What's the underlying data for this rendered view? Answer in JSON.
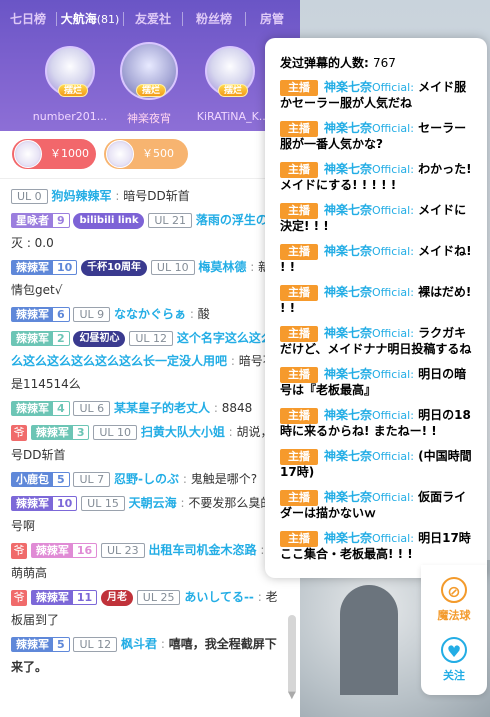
{
  "tabs": [
    {
      "label": "七日榜",
      "count": ""
    },
    {
      "label": "大航海",
      "count": "(81)"
    },
    {
      "label": "友爱社",
      "count": ""
    },
    {
      "label": "粉丝榜",
      "count": ""
    },
    {
      "label": "房管",
      "count": ""
    }
  ],
  "rank_badge": "摆烂",
  "rank_names": [
    "number201...",
    "神楽夜宵",
    "KiRATiNA_K..."
  ],
  "gifts": [
    {
      "text": "￥1000",
      "color": "#f2676b"
    },
    {
      "text": "￥500",
      "color": "#f7b470"
    }
  ],
  "chat": [
    {
      "fan": "UL 0",
      "fan_lv": "",
      "ul": "",
      "guard": "",
      "medal": "",
      "user": "狗妈辣辣军",
      "sep": ":",
      "text": "暗号DD斩首",
      "fan_color": "#ffffff",
      "plain_ul": "UL 0"
    },
    {
      "fan": "星咏者",
      "fan_lv": "9",
      "ul": "UL 21",
      "guard": "",
      "medal": "bilibili link",
      "user": "落雨の浮生の",
      "sep": "",
      "text": "幻灭 : 0.0",
      "fan_color": "#9b7ede"
    },
    {
      "fan": "辣辣军",
      "fan_lv": "10",
      "ul": "UL 10",
      "guard": "",
      "medal": "千杯10周年",
      "user": "梅莫林德",
      "sep": ":",
      "text": "新表情包get√",
      "fan_color": "#5f88d9"
    },
    {
      "fan": "辣辣军",
      "fan_lv": "6",
      "ul": "UL 9",
      "guard": "",
      "medal": "",
      "user": "ななかぐらぁ",
      "sep": ":",
      "text": "酸",
      "fan_color": "#5f88d9"
    },
    {
      "fan": "辣辣军",
      "fan_lv": "2",
      "ul": "UL 12",
      "guard": "",
      "medal": "幻昼初心",
      "user": "这个名字这么这么这么这么这么这么这么这么长一定没人用吧",
      "sep": ":",
      "text": "暗号不是114514么",
      "fan_color": "#6cc5b5"
    },
    {
      "fan": "辣辣军",
      "fan_lv": "4",
      "ul": "UL 6",
      "guard": "",
      "medal": "",
      "user": "某某皇子的老丈人",
      "sep": ":",
      "text": "8848",
      "fan_color": "#6cc5b5"
    },
    {
      "fan": "辣辣军",
      "fan_lv": "3",
      "ul": "UL 10",
      "guard": "爷",
      "medal": "",
      "user": "扫黄大队大小姐",
      "sep": ":",
      "text": "胡说，暗号DD斩首",
      "fan_color": "#6cc5b5"
    },
    {
      "fan": "小鹿包",
      "fan_lv": "5",
      "ul": "UL 7",
      "guard": "",
      "medal": "",
      "user": "忍野-しのぶ",
      "sep": ":",
      "text": "鬼触是哪个?",
      "fan_color": "#5f88d9"
    },
    {
      "fan": "辣辣军",
      "fan_lv": "10",
      "ul": "UL 15",
      "guard": "",
      "medal": "",
      "user": "天朝云海",
      "sep": ":",
      "text": "不要发那么臭的暗号啊",
      "fan_color": "#7c68d8"
    },
    {
      "fan": "辣辣军",
      "fan_lv": "16",
      "ul": "UL 23",
      "guard": "爷",
      "medal": "",
      "user": "出租车司机金木恣路",
      "sep": ":",
      "text": "大萌萌高",
      "fan_color": "#e08bd5"
    },
    {
      "fan": "辣辣军",
      "fan_lv": "11",
      "ul": "UL 25",
      "guard": "爷",
      "medal": "月老",
      "user": "あいしてる--",
      "sep": ":",
      "text": "老板届到了",
      "fan_color": "#7c68d8"
    },
    {
      "fan": "辣辣军",
      "fan_lv": "5",
      "ul": "UL 12",
      "guard": "",
      "medal": "",
      "user": "枫斗君",
      "sep": ":",
      "text": "嘻嘻，我全程截屏下来了。",
      "fan_color": "#5f88d9",
      "bold": true
    }
  ],
  "popup": {
    "title": "发过弹幕的人数",
    "count": "767",
    "role": "主播",
    "name": "神楽七奈",
    "official": "Official:",
    "messages": [
      "メイド服かセーラー服が人気だね",
      "セーラー服が一番人気かな?",
      "わかった! メイドにする! ! ! ! !",
      "メイドに決定! ! !",
      "メイドね! ! !",
      "裸はだめ! ! !",
      "ラクガキだけど、メイドナナ明日投稿するね",
      "明日の暗号は『老板最高』",
      "明日の18時に来るからね! またねー! !",
      "(中国時間17時)",
      "仮面ライダーは描かないｗ",
      "明日17時ここ集合・老板最高! ! !"
    ]
  },
  "side": {
    "magic": "魔法球",
    "follow": "关注"
  }
}
